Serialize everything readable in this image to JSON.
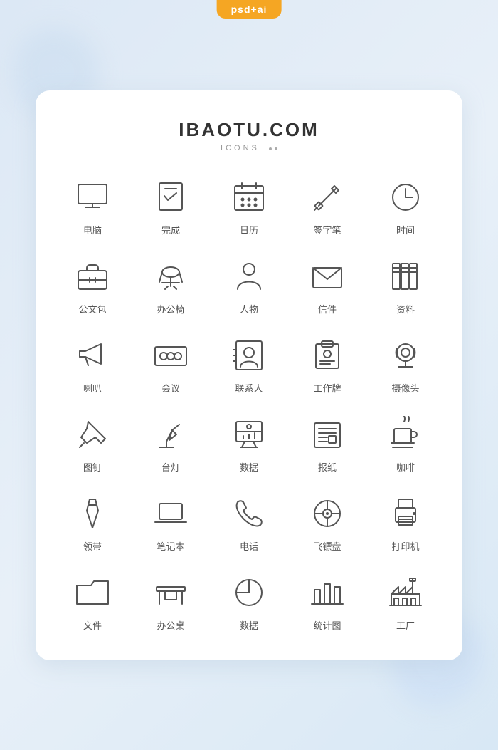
{
  "badge": "psd+ai",
  "header": {
    "title": "IBAOTU.COM",
    "subtitle": "ICONS"
  },
  "icons": [
    {
      "id": "computer",
      "label": "电脑"
    },
    {
      "id": "done",
      "label": "完成"
    },
    {
      "id": "calendar",
      "label": "日历"
    },
    {
      "id": "pen",
      "label": "签字笔"
    },
    {
      "id": "clock",
      "label": "时间"
    },
    {
      "id": "briefcase",
      "label": "公文包"
    },
    {
      "id": "office-chair",
      "label": "办公椅"
    },
    {
      "id": "person",
      "label": "人物"
    },
    {
      "id": "mail",
      "label": "信件"
    },
    {
      "id": "files",
      "label": "资料"
    },
    {
      "id": "megaphone",
      "label": "喇叭"
    },
    {
      "id": "meeting",
      "label": "会议"
    },
    {
      "id": "contact",
      "label": "联系人"
    },
    {
      "id": "badge",
      "label": "工作牌"
    },
    {
      "id": "camera",
      "label": "摄像头"
    },
    {
      "id": "pushpin",
      "label": "图钉"
    },
    {
      "id": "desk-lamp",
      "label": "台灯"
    },
    {
      "id": "data-screen",
      "label": "数据"
    },
    {
      "id": "newspaper",
      "label": "报纸"
    },
    {
      "id": "coffee",
      "label": "咖啡"
    },
    {
      "id": "tie",
      "label": "领带"
    },
    {
      "id": "laptop",
      "label": "笔记本"
    },
    {
      "id": "phone",
      "label": "电话"
    },
    {
      "id": "frisbee",
      "label": "飞镖盘"
    },
    {
      "id": "printer",
      "label": "打印机"
    },
    {
      "id": "folder",
      "label": "文件"
    },
    {
      "id": "desk",
      "label": "办公桌"
    },
    {
      "id": "pie-chart",
      "label": "数据"
    },
    {
      "id": "bar-chart",
      "label": "统计图"
    },
    {
      "id": "factory",
      "label": "工厂"
    }
  ]
}
